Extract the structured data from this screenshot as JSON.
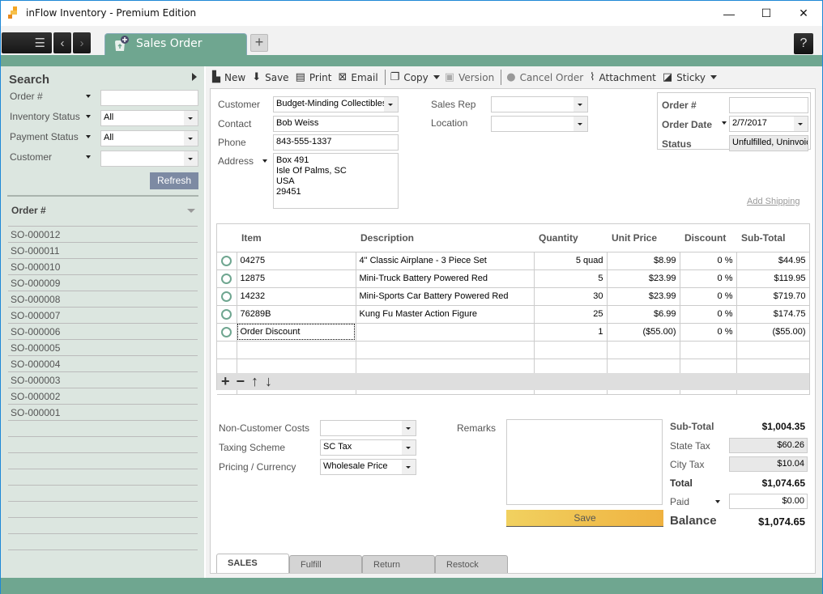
{
  "window": {
    "title": "inFlow Inventory - Premium Edition",
    "controls": {
      "minimize": "—",
      "maximize": "☐",
      "close": "✕"
    }
  },
  "tabbar": {
    "menu_icon": "☰",
    "back_icon": "‹",
    "forward_icon": "›",
    "active_tab": "Sales Order",
    "add_tab": "+",
    "help": "?"
  },
  "sidebar": {
    "title": "Search",
    "filters": [
      {
        "label": "Order #",
        "value": ""
      },
      {
        "label": "Inventory Status",
        "value": "All"
      },
      {
        "label": "Payment Status",
        "value": "All"
      },
      {
        "label": "Customer",
        "value": ""
      }
    ],
    "refresh_label": "Refresh",
    "list_header": "Order #",
    "orders": [
      "SO-000012",
      "SO-000011",
      "SO-000010",
      "SO-000009",
      "SO-000008",
      "SO-000007",
      "SO-000006",
      "SO-000005",
      "SO-000004",
      "SO-000003",
      "SO-000002",
      "SO-000001",
      "",
      "",
      "",
      "",
      "",
      "",
      "",
      "",
      ""
    ]
  },
  "toolbar": {
    "new": "New",
    "save": "Save",
    "print": "Print",
    "email": "Email",
    "copy": "Copy",
    "version": "Version",
    "cancel_order": "Cancel Order",
    "attachment": "Attachment",
    "sticky": "Sticky"
  },
  "header": {
    "customer_label": "Customer",
    "customer": "Budget-Minding Collectibles",
    "contact_label": "Contact",
    "contact": "Bob Weiss",
    "phone_label": "Phone",
    "phone": "843-555-1337",
    "address_label": "Address",
    "address_lines": [
      "Box 491",
      "Isle Of Palms, SC",
      "USA",
      "29451"
    ],
    "sales_rep_label": "Sales Rep",
    "sales_rep": "",
    "location_label": "Location",
    "location": "",
    "order_no_label": "Order #",
    "order_no": "",
    "order_date_label": "Order Date",
    "order_date": "2/7/2017",
    "status_label": "Status",
    "status": "Unfulfilled, Uninvoic",
    "add_shipping": "Add Shipping"
  },
  "items": {
    "columns": [
      "Item",
      "Description",
      "Quantity",
      "Unit Price",
      "Discount",
      "Sub-Total"
    ],
    "rows": [
      {
        "item": "04275",
        "description": "4\" Classic Airplane - 3 Piece Set",
        "quantity": "5 quad",
        "unit_price": "$8.99",
        "discount": "0 %",
        "subtotal": "$44.95"
      },
      {
        "item": "12875",
        "description": "Mini-Truck Battery Powered Red",
        "quantity": "5",
        "unit_price": "$23.99",
        "discount": "0 %",
        "subtotal": "$119.95"
      },
      {
        "item": "14232",
        "description": "Mini-Sports Car Battery Powered Red",
        "quantity": "30",
        "unit_price": "$23.99",
        "discount": "0 %",
        "subtotal": "$719.70"
      },
      {
        "item": "76289B",
        "description": "Kung Fu Master Action Figure",
        "quantity": "25",
        "unit_price": "$6.99",
        "discount": "0 %",
        "subtotal": "$174.75"
      },
      {
        "item": "Order Discount",
        "description": "",
        "quantity": "1",
        "unit_price": "($55.00)",
        "discount": "0 %",
        "subtotal": "($55.00)"
      }
    ],
    "tools": {
      "add": "+",
      "remove": "−",
      "up": "↑",
      "down": "↓"
    }
  },
  "footer": {
    "non_customer_costs_label": "Non-Customer Costs",
    "non_customer_costs": "",
    "taxing_scheme_label": "Taxing Scheme",
    "taxing_scheme": "SC Tax",
    "pricing_label": "Pricing / Currency",
    "pricing": "Wholesale Price",
    "remarks_label": "Remarks",
    "remarks": "",
    "save_label": "Save"
  },
  "totals": {
    "subtotal_label": "Sub-Total",
    "subtotal": "$1,004.35",
    "state_tax_label": "State Tax",
    "state_tax": "$60.26",
    "city_tax_label": "City Tax",
    "city_tax": "$10.04",
    "total_label": "Total",
    "total": "$1,074.65",
    "paid_label": "Paid",
    "paid": "$0.00",
    "balance_label": "Balance",
    "balance": "$1,074.65"
  },
  "bottom_tabs": [
    "SALES",
    "Fulfill",
    "Return",
    "Restock"
  ],
  "colors": {
    "accent_green": "#6fa690",
    "save_gold": "#efb240",
    "refresh_blue": "#7d8aa3"
  }
}
